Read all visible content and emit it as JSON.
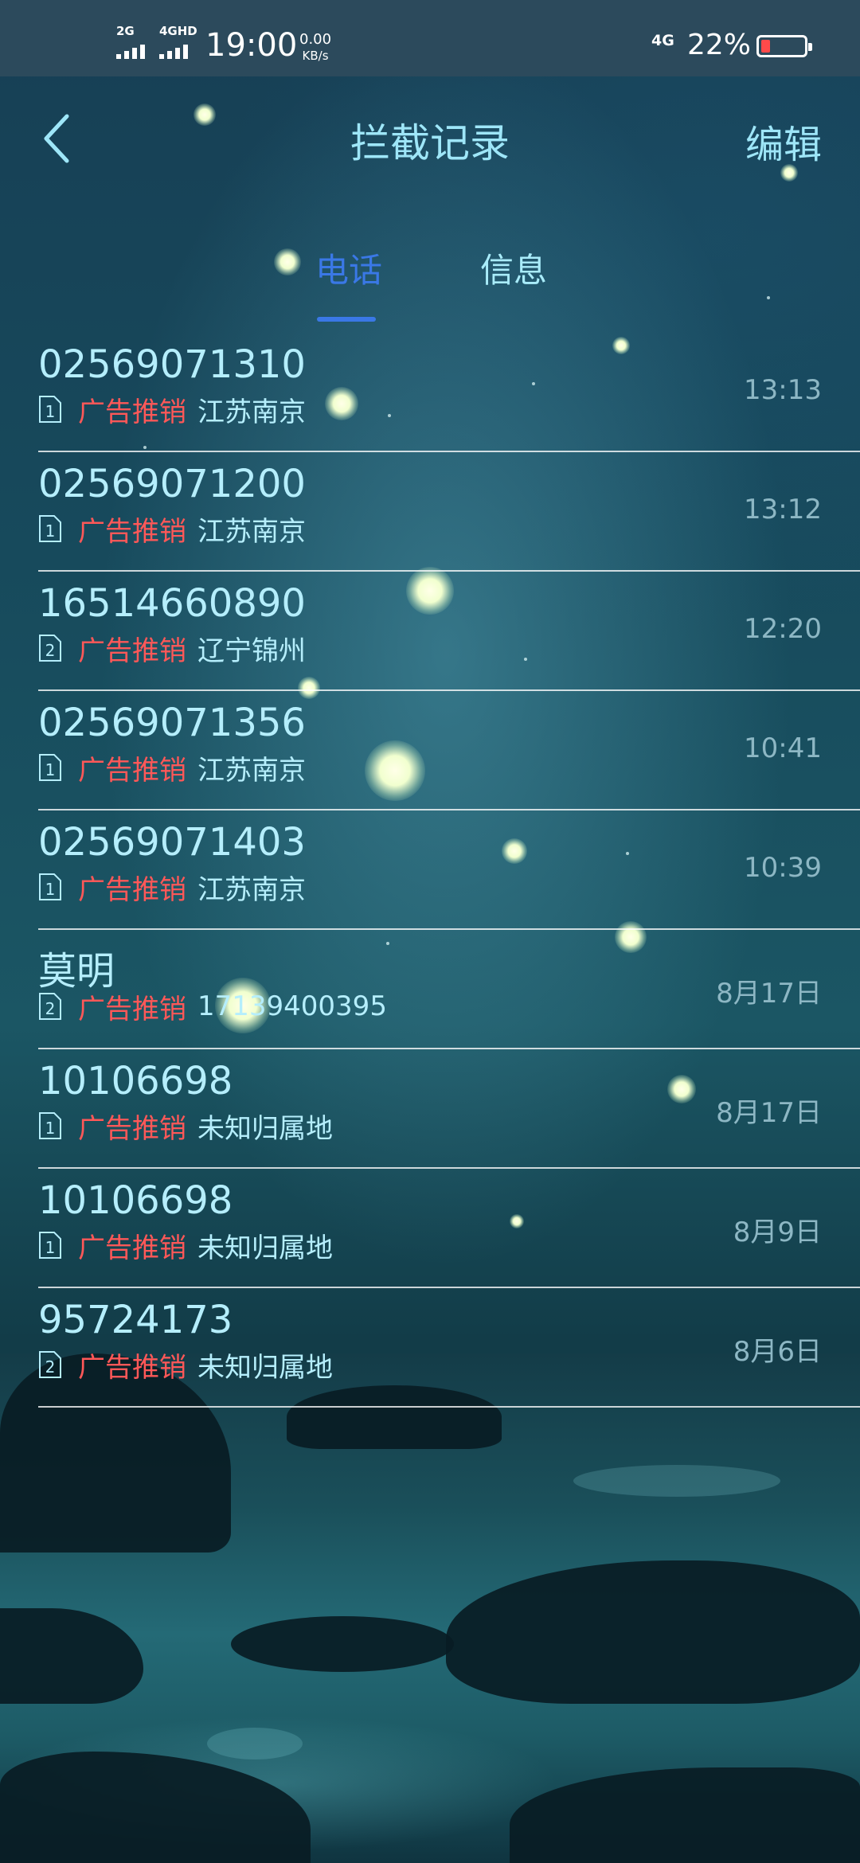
{
  "status_bar": {
    "sim1_type": "2G",
    "sim2_type": "4GHD",
    "time": "19:00",
    "speed_value": "0.00",
    "speed_unit": "KB/s",
    "network_badge": "4G",
    "battery_percent": "22%",
    "battery_level": 0.22,
    "battery_color": "#ff4a4a"
  },
  "header": {
    "back_icon": "chevron-left-icon",
    "title": "拦截记录",
    "edit_label": "编辑"
  },
  "tabs": [
    {
      "label": "电话",
      "active": true
    },
    {
      "label": "信息",
      "active": false
    }
  ],
  "colors": {
    "accent_blue": "#3a78e6",
    "tag_red": "#ff5858",
    "text_cyan": "#b5eefc"
  },
  "records": [
    {
      "title": "02569071310",
      "sim": "1",
      "tag": "广告推销",
      "location": "江苏南京",
      "time": "13:13"
    },
    {
      "title": "02569071200",
      "sim": "1",
      "tag": "广告推销",
      "location": "江苏南京",
      "time": "13:12"
    },
    {
      "title": "16514660890",
      "sim": "2",
      "tag": "广告推销",
      "location": "辽宁锦州",
      "time": "12:20"
    },
    {
      "title": "02569071356",
      "sim": "1",
      "tag": "广告推销",
      "location": "江苏南京",
      "time": "10:41"
    },
    {
      "title": "02569071403",
      "sim": "1",
      "tag": "广告推销",
      "location": "江苏南京",
      "time": "10:39"
    },
    {
      "title": "莫明",
      "sim": "2",
      "tag": "广告推销",
      "location": "17139400395",
      "time": "8月17日"
    },
    {
      "title": "10106698",
      "sim": "1",
      "tag": "广告推销",
      "location": "未知归属地",
      "time": "8月17日"
    },
    {
      "title": "10106698",
      "sim": "1",
      "tag": "广告推销",
      "location": "未知归属地",
      "time": "8月9日"
    },
    {
      "title": "95724173",
      "sim": "2",
      "tag": "广告推销",
      "location": "未知归属地",
      "time": "8月6日"
    }
  ]
}
